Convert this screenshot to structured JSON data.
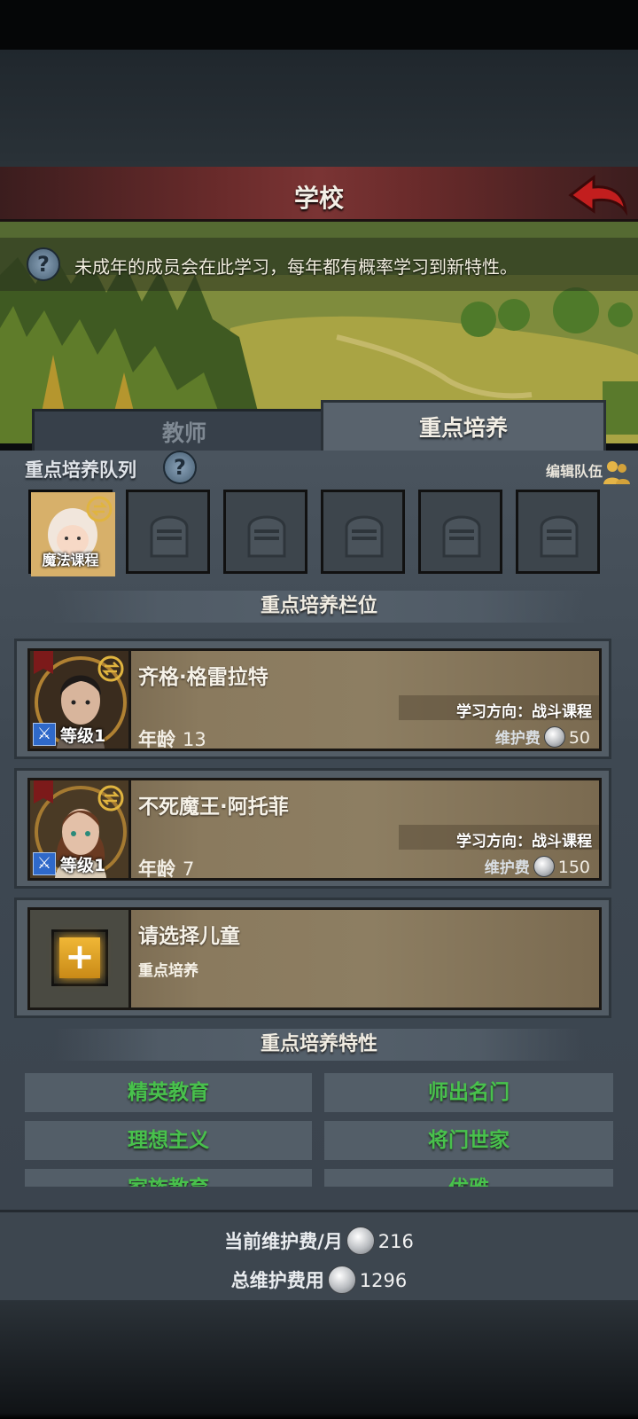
{
  "header": {
    "title": "学校"
  },
  "info": {
    "text": "未成年的成员会在此学习，每年都有概率学习到新特性。",
    "help_glyph": "?"
  },
  "tabs": [
    {
      "label": "教师",
      "active": false
    },
    {
      "label": "重点培养",
      "active": true
    }
  ],
  "queue": {
    "title": "重点培养队列",
    "edit_label": "编辑队伍",
    "slots": [
      {
        "label": "魔法课程",
        "filled": true
      },
      {
        "filled": false
      },
      {
        "filled": false
      },
      {
        "filled": false
      },
      {
        "filled": false
      },
      {
        "filled": false
      }
    ]
  },
  "slots_section": {
    "title": "重点培养栏位"
  },
  "children": [
    {
      "name": "齐格·格雷拉特",
      "level": "等级1",
      "direction": "学习方向：战斗课程",
      "age_label": "年龄",
      "age": "13",
      "fee_label": "维护费",
      "fee": "50"
    },
    {
      "name": "不死魔王·阿托菲",
      "level": "等级1",
      "direction": "学习方向：战斗课程",
      "age_label": "年龄",
      "age": "7",
      "fee_label": "维护费",
      "fee": "150"
    }
  ],
  "empty_slot": {
    "title": "请选择儿童",
    "subtitle": "重点培养"
  },
  "traits": {
    "title": "重点培养特性",
    "items": [
      "精英教育",
      "师出名门",
      "理想主义",
      "将门世家",
      "家族教育",
      "优雅"
    ]
  },
  "footer": {
    "monthly_label": "当前维护费/月",
    "monthly_value": "216",
    "total_label": "总维护费用",
    "total_value": "1296"
  },
  "colors": {
    "trait_green": "#48c14c",
    "title_bar": "#6a2b2b",
    "back_arrow": "#c21e1e"
  }
}
